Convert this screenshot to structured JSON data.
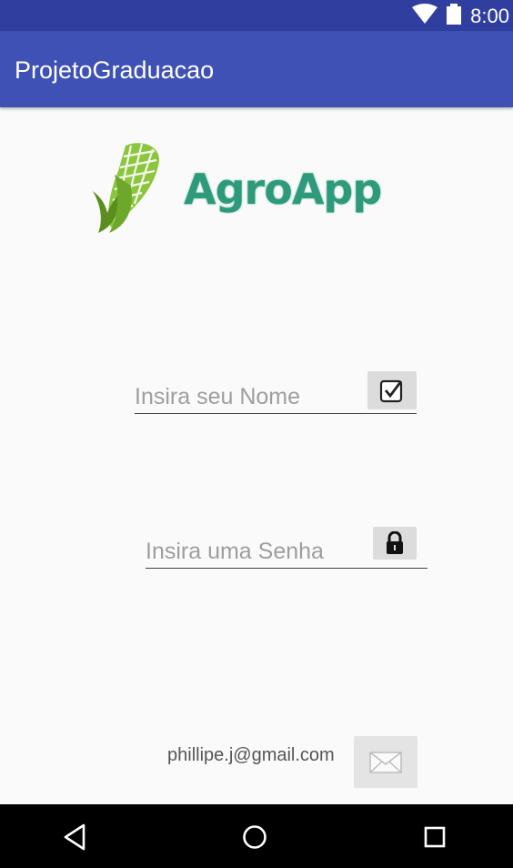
{
  "status_bar": {
    "time": "8:00",
    "wifi_icon": "wifi-icon",
    "battery_icon": "battery-icon"
  },
  "app_bar": {
    "title": "ProjetoGraduacao"
  },
  "logo": {
    "text": "AgroApp",
    "icon": "corn-icon"
  },
  "form": {
    "name_placeholder": "Insira seu Nome",
    "name_value": "",
    "name_icon": "checkbox-icon",
    "password_placeholder": "Insira uma Senha",
    "password_value": "",
    "password_icon": "lock-icon"
  },
  "footer": {
    "email": "phillipe.j@gmail.com",
    "mail_icon": "envelope-icon"
  },
  "nav_bar": {
    "back_icon": "back-icon",
    "home_icon": "home-icon",
    "recent_icon": "recent-apps-icon"
  },
  "colors": {
    "status_bar": "#303f9f",
    "app_bar": "#3f51b5",
    "logo_text": "#2e9a7c",
    "corn_green": "#7ab32e"
  }
}
